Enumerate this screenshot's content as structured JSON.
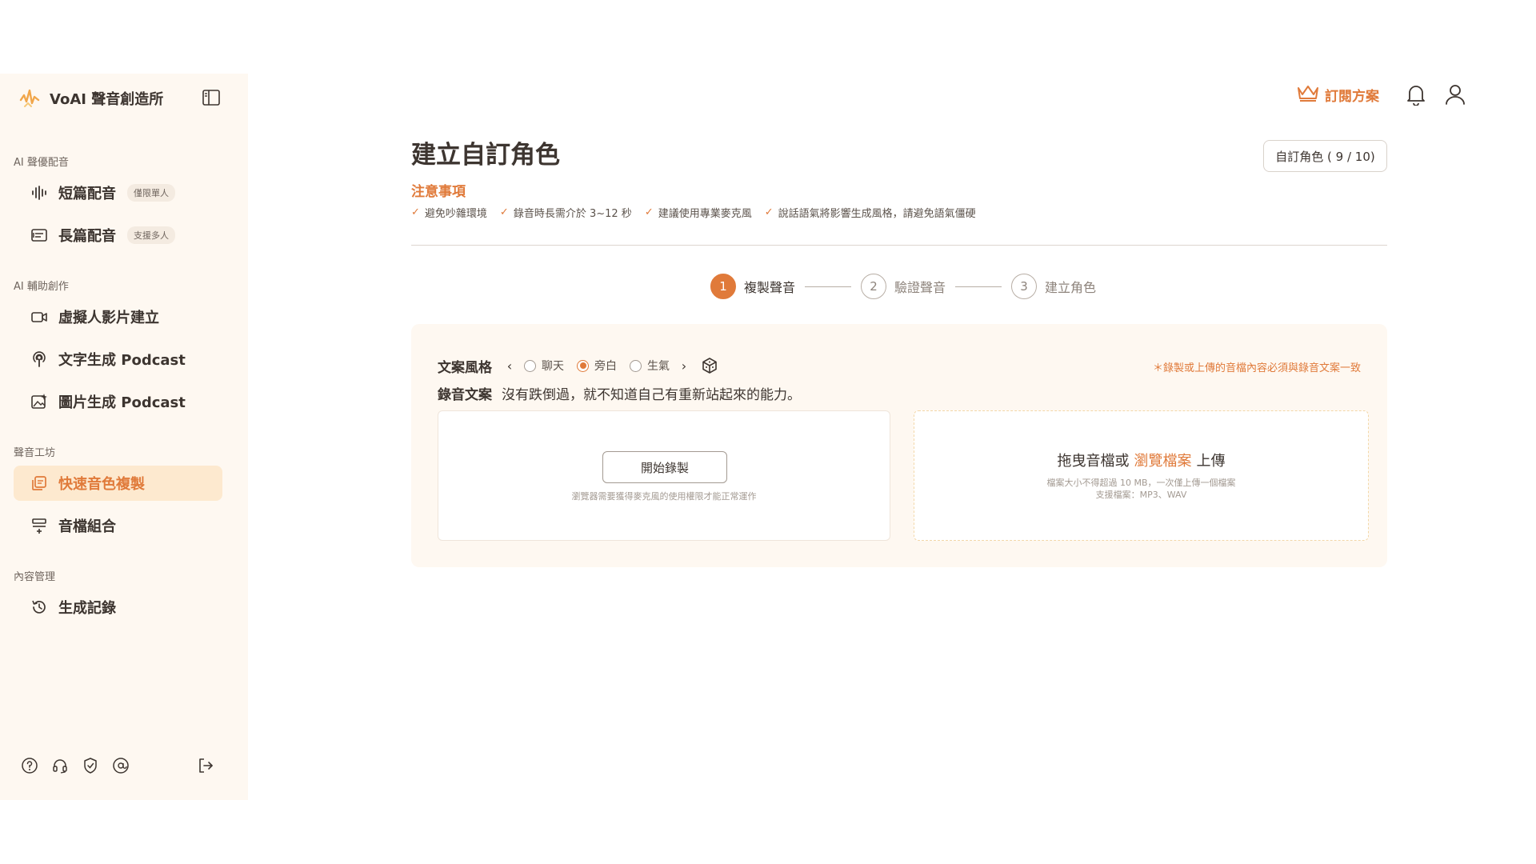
{
  "brand": {
    "name": "VoAI 聲音創造所"
  },
  "sidebar": {
    "sections": [
      {
        "label": "AI 聲優配音"
      },
      {
        "label": "AI 輔助創作"
      },
      {
        "label": "聲音工坊"
      },
      {
        "label": "內容管理"
      }
    ],
    "items": [
      {
        "label": "短篇配音",
        "tag": "僅限單人",
        "icon": "waveform-icon"
      },
      {
        "label": "長篇配音",
        "tag": "支援多人",
        "icon": "document-list-icon"
      },
      {
        "label": "虛擬人影片建立",
        "icon": "video-camera-icon"
      },
      {
        "label": "文字生成 Podcast",
        "icon": "podcast-icon"
      },
      {
        "label": "圖片生成 Podcast",
        "icon": "image-sparkle-icon"
      },
      {
        "label": "快速音色複製",
        "icon": "copy-voice-icon",
        "active": true
      },
      {
        "label": "音檔組合",
        "icon": "merge-audio-icon"
      },
      {
        "label": "生成記錄",
        "icon": "history-icon"
      }
    ],
    "footer_icons": [
      "help-icon",
      "headset-icon",
      "shield-check-icon",
      "at-sign-icon",
      "logout-icon"
    ]
  },
  "topbar": {
    "subscribe_label": "訂閱方案"
  },
  "main": {
    "title": "建立自訂角色",
    "char_count": "自訂角色 ( 9 / 10)",
    "notes_title": "注意事項",
    "notes": [
      "避免吵雜環境",
      "錄音時長需介於 3~12 秒",
      "建議使用專業麥克風",
      "說話語氣將影響生成風格，請避免語氣僵硬"
    ],
    "steps": [
      {
        "num": "1",
        "label": "複製聲音",
        "active": true
      },
      {
        "num": "2",
        "label": "驗證聲音"
      },
      {
        "num": "3",
        "label": "建立角色"
      }
    ],
    "panel": {
      "style_title": "文案風格",
      "styles": [
        "聊天",
        "旁白",
        "生氣"
      ],
      "selected_style": "旁白",
      "warning": "＊錄製或上傳的音檔內容必須與錄音文案一致",
      "script_title": "錄音文案",
      "script_text": "沒有跌倒過，就不知道自己有重新站起來的能力。",
      "record_button": "開始錄製",
      "record_hint": "瀏覽器需要獲得麥克風的使用權限才能正常運作",
      "upload_prefix": "拖曳音檔或",
      "upload_browse": "瀏覽檔案",
      "upload_suffix": "上傳",
      "upload_limit": "檔案大小不得超過 10 MB，一次僅上傳一個檔案",
      "upload_formats": "支援檔案：MP3、WAV"
    }
  },
  "colors": {
    "accent": "#e07a3a",
    "sidebar_bg": "#fef8f1",
    "active_bg": "#fde9cf"
  }
}
